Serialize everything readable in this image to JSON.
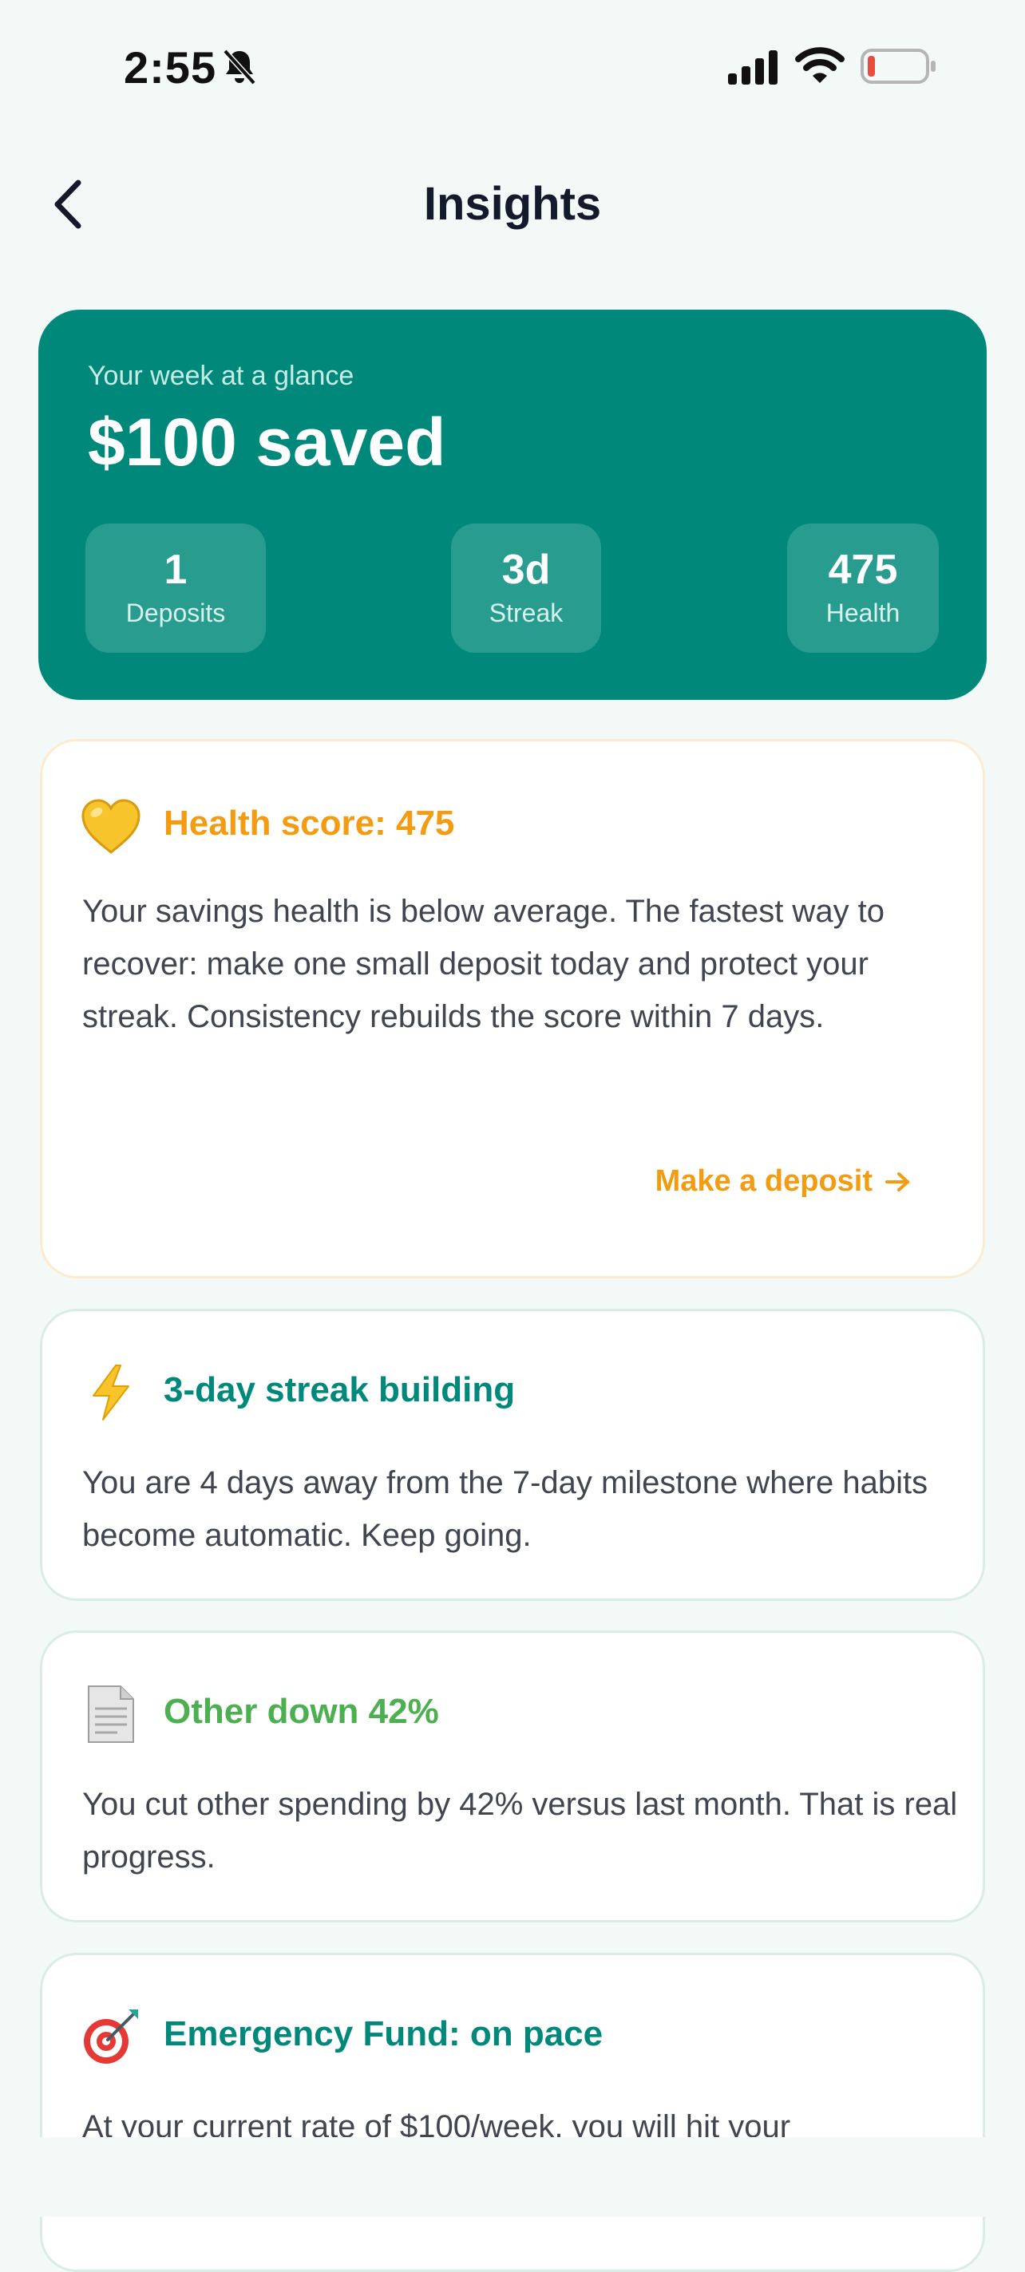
{
  "status_bar": {
    "time": "2:55"
  },
  "nav": {
    "title": "Insights"
  },
  "summary": {
    "subtitle": "Your week at a glance",
    "total": "$100 saved",
    "stats": [
      {
        "value": "1",
        "label": "Deposits"
      },
      {
        "value": "3d",
        "label": "Streak"
      },
      {
        "value": "475",
        "label": "Health"
      }
    ]
  },
  "cards": [
    {
      "icon": "yellow-heart-icon",
      "title": "Health score: 475",
      "title_color": "#f39c12",
      "body": "Your savings health is below average. The fastest way to recover: make one small deposit today and protect your streak. Consistency rebuilds the score within 7 days.",
      "action_label": "Make a deposit"
    },
    {
      "icon": "lightning-icon",
      "title": "3-day streak building",
      "title_color": "#00897b",
      "body": "You are 4 days away from the 7-day milestone where habits become automatic. Keep going."
    },
    {
      "icon": "document-icon",
      "title": "Other down 42%",
      "title_color": "#4caf50",
      "body": "You cut other spending by 42% versus last month. That is real progress."
    },
    {
      "icon": "target-icon",
      "title": "Emergency Fund: on pace",
      "title_color": "#00897b",
      "body": "At your current rate of $100/week, you will hit your"
    }
  ],
  "colors": {
    "accent": "#00897b",
    "warning": "#f39c12",
    "success": "#4caf50",
    "background": "#f3f9f7"
  }
}
